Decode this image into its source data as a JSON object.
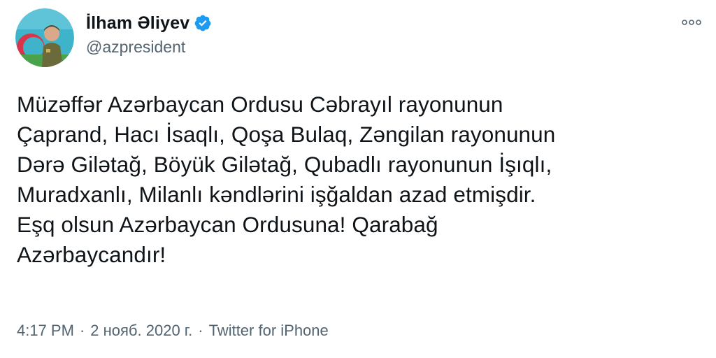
{
  "tweet": {
    "author": {
      "display_name": "İlham Əliyev",
      "handle": "@azpresident",
      "verified_icon": "verified-badge-icon",
      "avatar_icon": "profile-avatar"
    },
    "more_icon": "more-dots-icon",
    "text": "Müzəffər Azərbaycan Ordusu Cəbrayıl rayonunun\nÇaprand, Hacı İsaqlı, Qoşa Bulaq, Zəngilan rayonunun\nDərə Gilətağ, Böyük Gilətağ, Qubadlı rayonunun İşıqlı,\nMuradxanlı, Milanlı kəndlərini işğaldan azad etmişdir.\nEşq olsun Azərbaycan Ordusuna! Qarabağ\nAzərbaycandır!",
    "meta": {
      "time": "4:17 PM",
      "separator": "·",
      "date": "2 нояб. 2020 г.",
      "source": "Twitter for iPhone"
    }
  },
  "colors": {
    "text": "#0f1419",
    "secondary": "#536471",
    "verified": "#1d9bf0"
  }
}
